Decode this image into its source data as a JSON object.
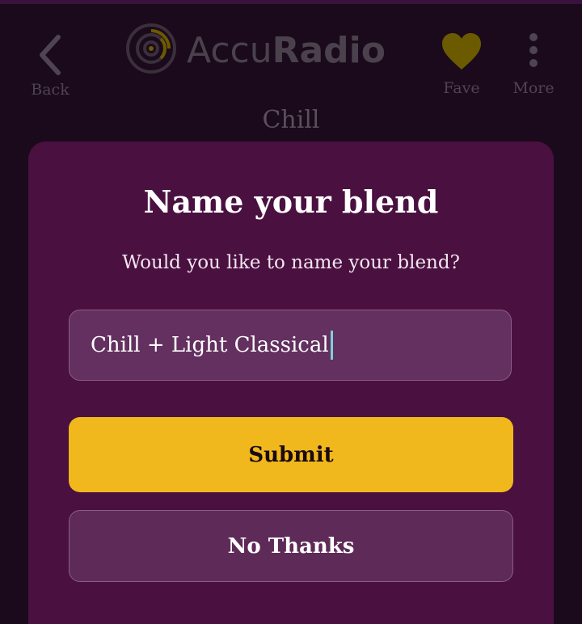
{
  "header": {
    "back_label": "Back",
    "logo_text_light": "Accu",
    "logo_text_bold": "Radio",
    "fave_label": "Fave",
    "more_label": "More",
    "station_title": "Chill"
  },
  "modal": {
    "title": "Name your blend",
    "subtitle": "Would you like to name your blend?",
    "input_value": "Chill + Light Classical",
    "submit_label": "Submit",
    "no_thanks_label": "No Thanks"
  },
  "colors": {
    "background": "#1a0a1c",
    "modal": "#4a1040",
    "submit": "#f0b81c",
    "fave_heart": "#6b5a00"
  }
}
